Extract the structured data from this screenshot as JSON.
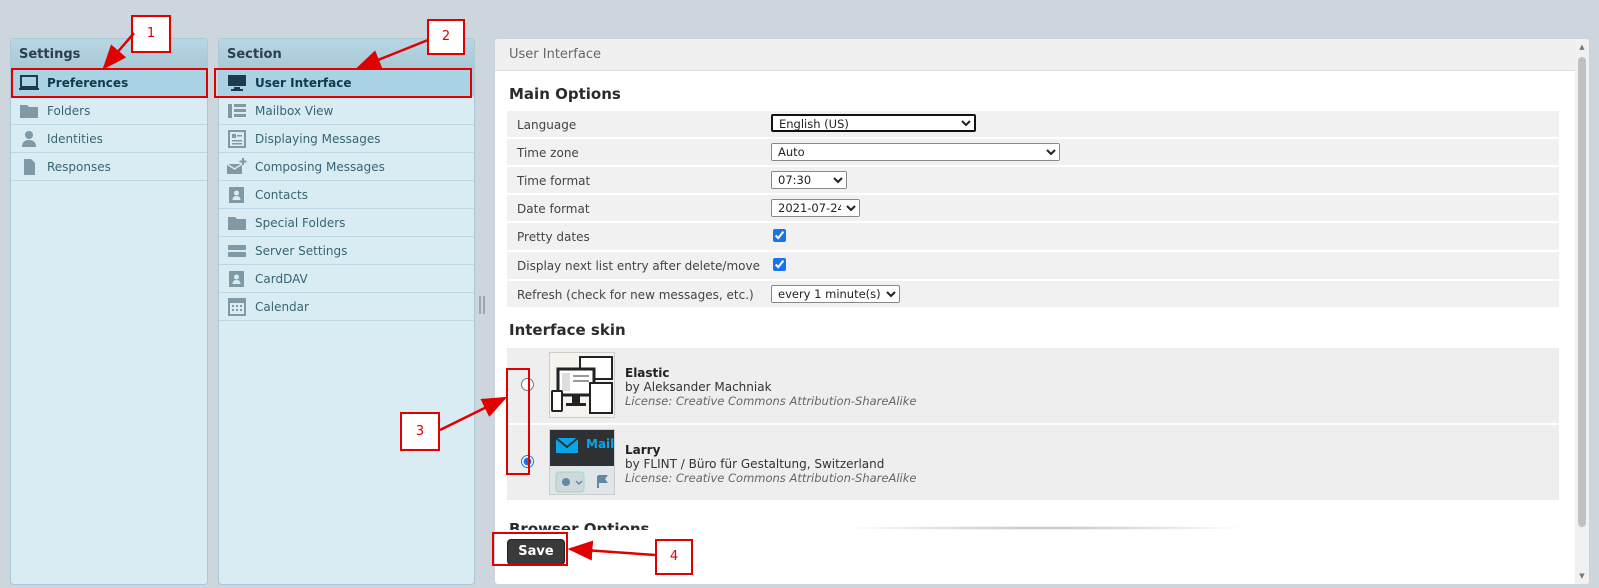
{
  "settings": {
    "header": "Settings",
    "items": [
      {
        "label": "Preferences",
        "icon": "monitor-icon",
        "selected": true
      },
      {
        "label": "Folders",
        "icon": "folder-icon"
      },
      {
        "label": "Identities",
        "icon": "person-icon"
      },
      {
        "label": "Responses",
        "icon": "document-icon"
      }
    ]
  },
  "section": {
    "header": "Section",
    "items": [
      {
        "label": "User Interface",
        "icon": "monitor-icon",
        "selected": true
      },
      {
        "label": "Mailbox View",
        "icon": "list-layout-icon"
      },
      {
        "label": "Displaying Messages",
        "icon": "message-view-icon"
      },
      {
        "label": "Composing Messages",
        "icon": "compose-icon"
      },
      {
        "label": "Contacts",
        "icon": "contact-card-icon"
      },
      {
        "label": "Special Folders",
        "icon": "folder-icon"
      },
      {
        "label": "Server Settings",
        "icon": "server-icon"
      },
      {
        "label": "CardDAV",
        "icon": "contact-card-icon"
      },
      {
        "label": "Calendar",
        "icon": "calendar-icon"
      }
    ]
  },
  "content": {
    "header": "User Interface",
    "main_options_title": "Main Options",
    "options": [
      {
        "label": "Language",
        "type": "select",
        "value": "English (US)"
      },
      {
        "label": "Time zone",
        "type": "select",
        "value": "Auto"
      },
      {
        "label": "Time format",
        "type": "select",
        "value": "07:30"
      },
      {
        "label": "Date format",
        "type": "select",
        "value": "2021-07-24"
      },
      {
        "label": "Pretty dates",
        "type": "checkbox",
        "checked": true
      },
      {
        "label": "Display next list entry after delete/move",
        "type": "checkbox",
        "checked": true
      },
      {
        "label": "Refresh (check for new messages, etc.)",
        "type": "select",
        "value": "every 1 minute(s)"
      }
    ],
    "skin_title": "Interface skin",
    "skins": [
      {
        "name": "Elastic",
        "author": "by Aleksander Machniak",
        "license": "License: Creative Commons Attribution-ShareAlike",
        "selected": false
      },
      {
        "name": "Larry",
        "author": "by FLINT / Büro für Gestaltung, Switzerland",
        "license": "License: Creative Commons Attribution-ShareAlike",
        "selected": true,
        "thumb_label": "Mail"
      }
    ],
    "browser_options_title": "Browser Options",
    "save_label": "Save"
  },
  "annotations": [
    "1",
    "2",
    "3",
    "4"
  ],
  "colors": {
    "annotation": "#e00000",
    "panel_bg": "#d9ecf4",
    "selected_bg": "#a9d3e4",
    "save_button": "#3a3a3a"
  }
}
